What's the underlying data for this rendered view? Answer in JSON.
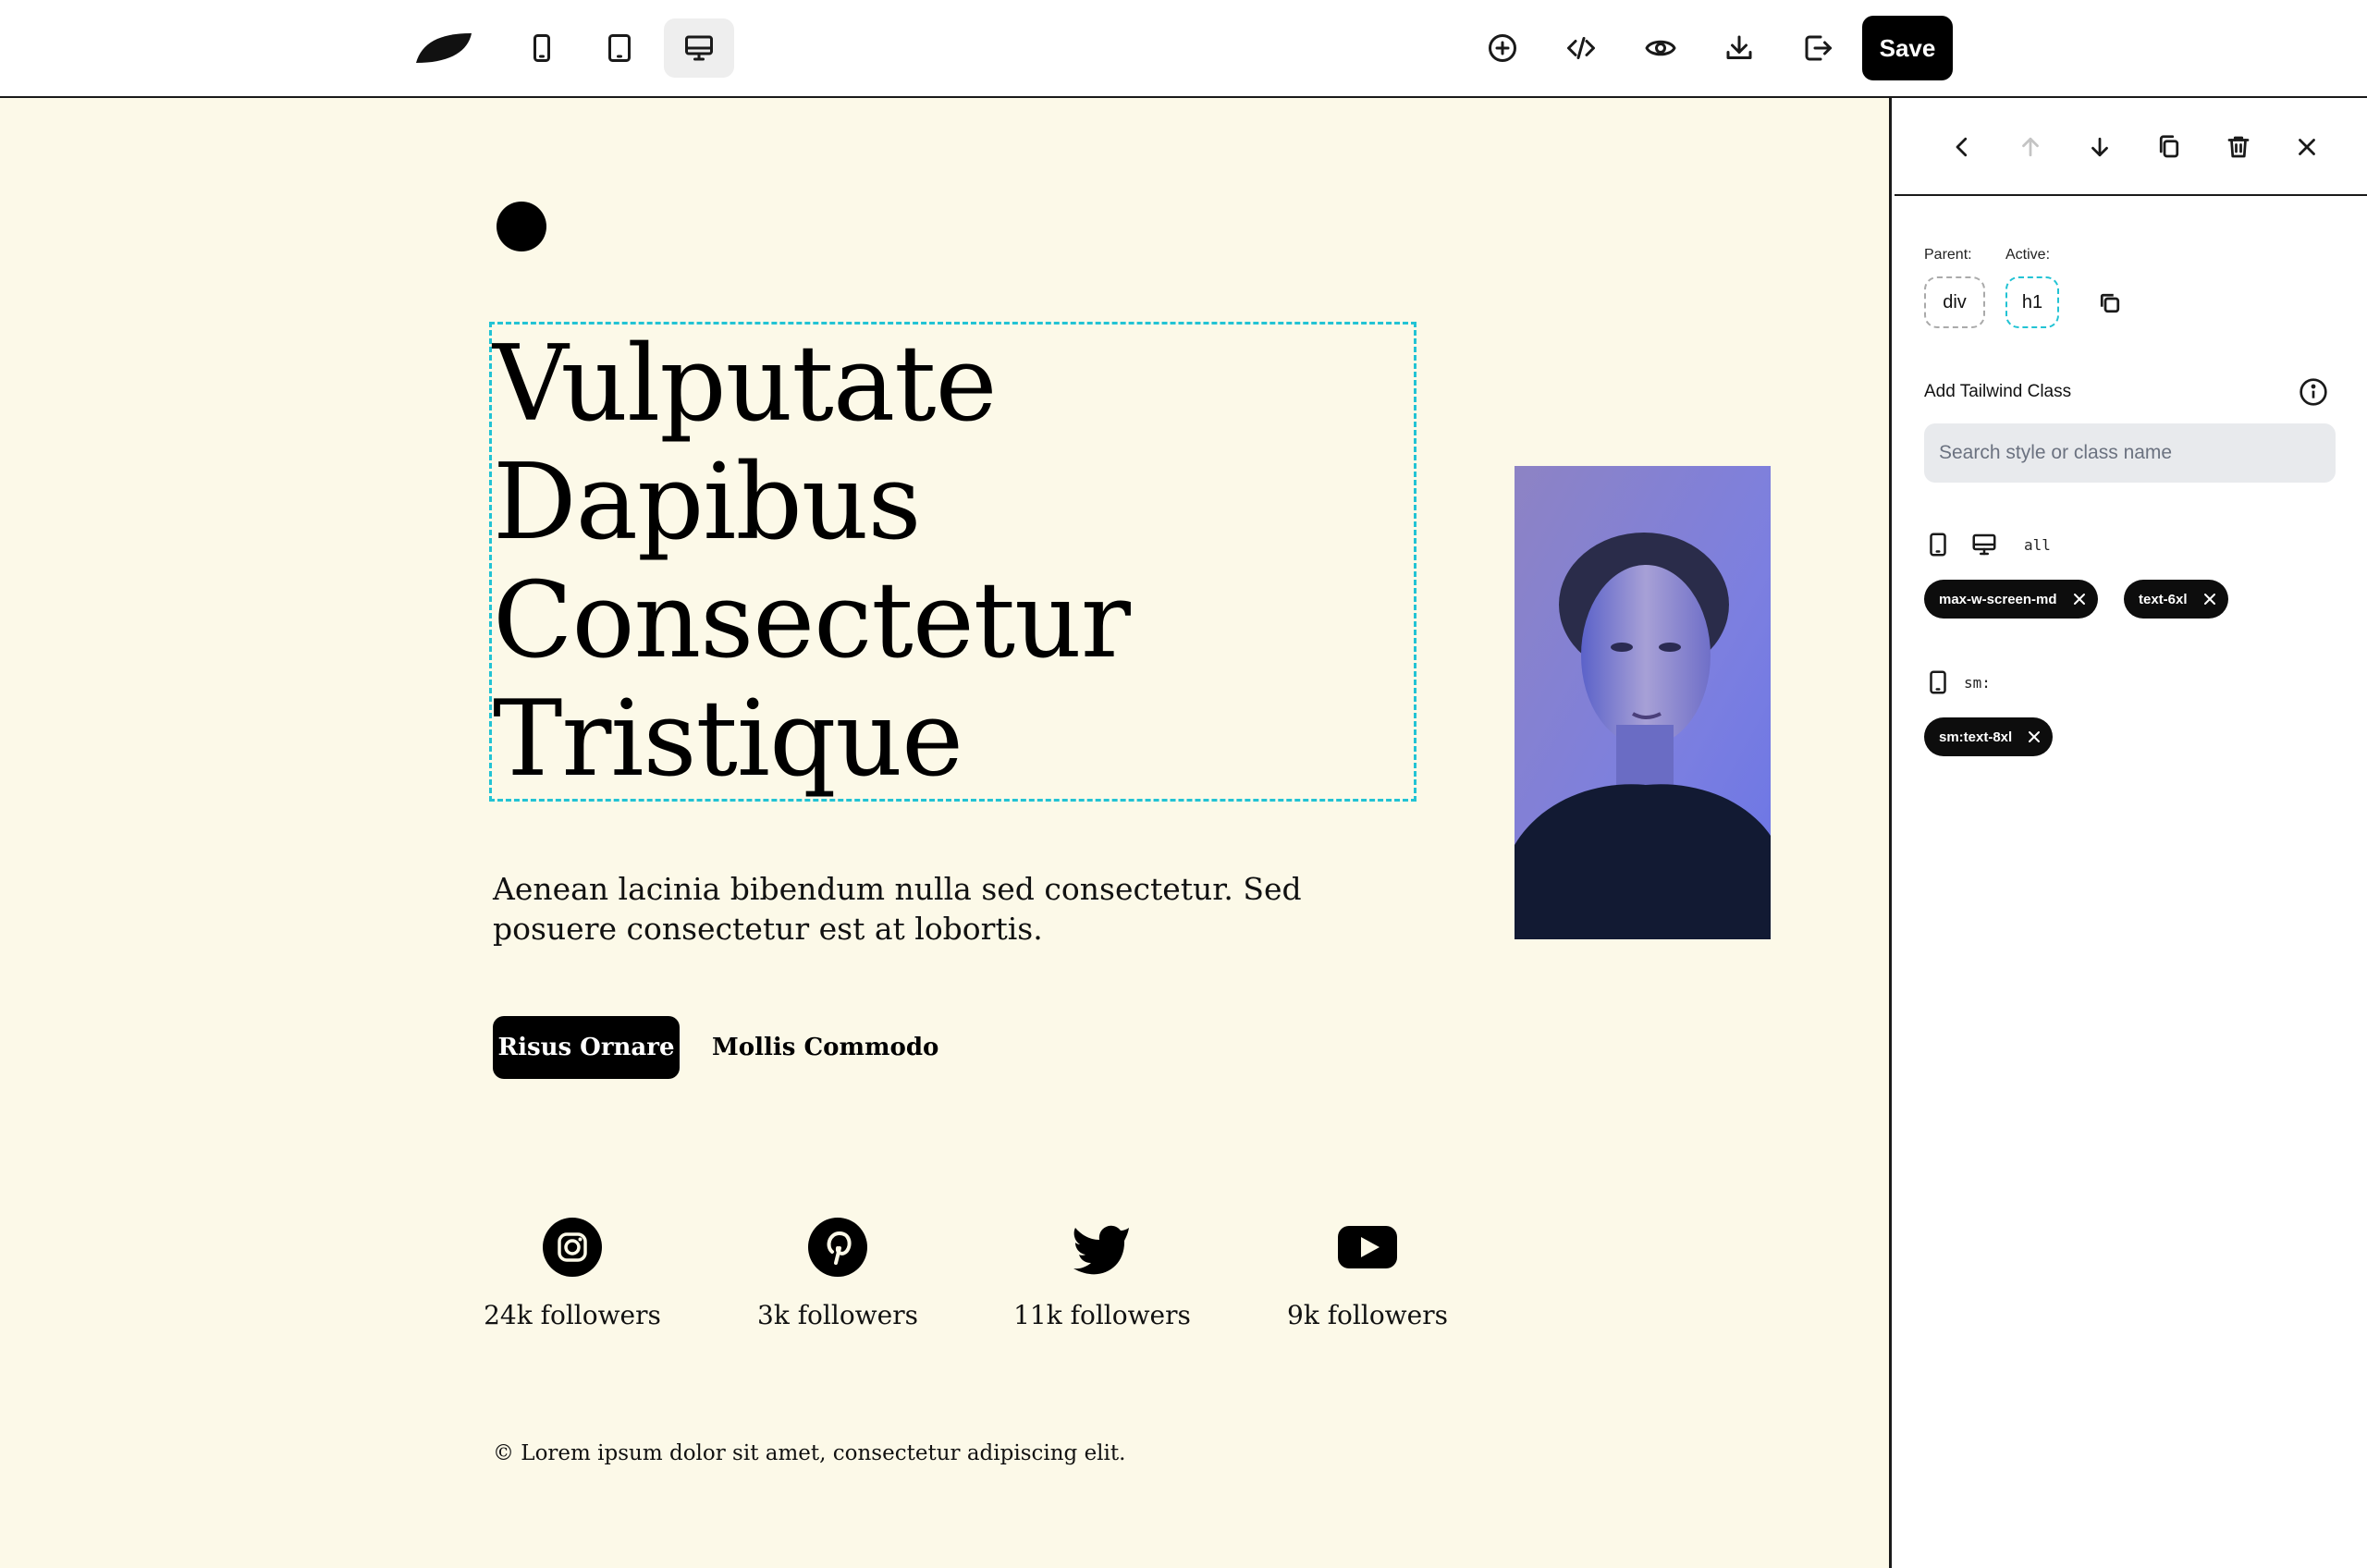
{
  "toolbar": {
    "devices": [
      "mobile",
      "tablet",
      "desktop"
    ],
    "active_device": "desktop",
    "actions": [
      "add-icon",
      "code-icon",
      "preview-eye-icon",
      "download-icon",
      "export-icon"
    ],
    "save_label": "Save"
  },
  "canvas": {
    "background": "#fcf9e8",
    "heading_lines": [
      "Vulputate",
      "Dapibus",
      "Consectetur",
      "Tristique"
    ],
    "lead": "Aenean lacinia bibendum nulla sed consectetur. Sed posuere consectetur est at lobortis.",
    "primary_button": "Risus Ornare",
    "secondary_button": "Mollis Commodo",
    "social": [
      {
        "icon": "instagram-icon",
        "count": "24k followers"
      },
      {
        "icon": "pinterest-icon",
        "count": "3k followers"
      },
      {
        "icon": "twitter-icon",
        "count": "11k followers"
      },
      {
        "icon": "youtube-icon",
        "count": "9k followers"
      }
    ],
    "footer": "© Lorem ipsum dolor sit amet, consectetur adipiscing elit.",
    "selection_color": "#22c3d4"
  },
  "panel": {
    "parent_label": "Parent:",
    "active_label": "Active:",
    "parent_element": "div",
    "active_element": "h1",
    "add_class_title": "Add Tailwind Class",
    "search_placeholder": "Search style or class name",
    "breakpoints": [
      {
        "label": "all",
        "classes": [
          "max-w-screen-md",
          "text-6xl"
        ]
      },
      {
        "label": "sm:",
        "classes": [
          "sm:text-8xl"
        ]
      }
    ]
  }
}
